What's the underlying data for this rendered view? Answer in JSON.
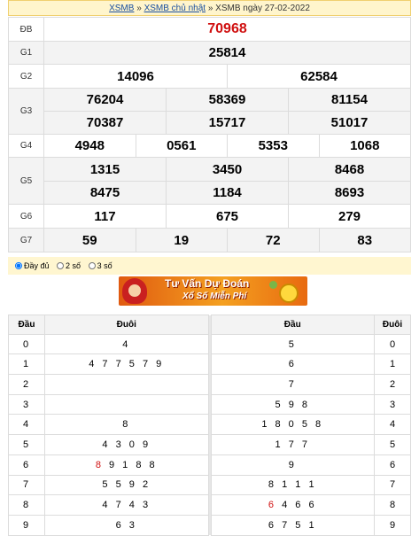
{
  "breadcrumb": {
    "link1": "XSMB",
    "sep1": "»",
    "link2": "XSMB chủ nhật",
    "sep2": "»",
    "current": "XSMB ngày 27-02-2022"
  },
  "results": [
    {
      "label": "ĐB",
      "numbers": [
        "70968"
      ]
    },
    {
      "label": "G1",
      "numbers": [
        "25814"
      ]
    },
    {
      "label": "G2",
      "numbers": [
        "14096",
        "62584"
      ]
    },
    {
      "label": "G3",
      "rows": [
        [
          "76204",
          "58369",
          "81154"
        ],
        [
          "70387",
          "15717",
          "51017"
        ]
      ]
    },
    {
      "label": "G4",
      "numbers": [
        "4948",
        "0561",
        "5353",
        "1068"
      ]
    },
    {
      "label": "G5",
      "rows": [
        [
          "1315",
          "3450",
          "8468"
        ],
        [
          "8475",
          "1184",
          "8693"
        ]
      ]
    },
    {
      "label": "G6",
      "numbers": [
        "117",
        "675",
        "279"
      ]
    },
    {
      "label": "G7",
      "numbers": [
        "59",
        "19",
        "72",
        "83"
      ]
    }
  ],
  "options": {
    "full": "Đầy đủ",
    "two": "2 số",
    "three": "3 số"
  },
  "banner": {
    "line1": "Tư Vấn Dự Đoán",
    "line2": "Xổ Số Miễn Phí"
  },
  "loto": {
    "headers": [
      "Đầu",
      "Đuôi",
      "Đầu",
      "Đuôi"
    ],
    "rows": [
      {
        "k": "0",
        "dau": "4",
        "duoi": "5",
        "k2": "0"
      },
      {
        "k": "1",
        "dau": "4 7 7 5 7 9",
        "duoi": "6",
        "k2": "1"
      },
      {
        "k": "2",
        "dau": "",
        "duoi": "7",
        "k2": "2"
      },
      {
        "k": "3",
        "dau": "",
        "duoi": "5 9 8",
        "k2": "3"
      },
      {
        "k": "4",
        "dau": "8",
        "duoi": "1 8 0 5 8",
        "k2": "4"
      },
      {
        "k": "5",
        "dau": "4 3 0 9",
        "duoi": "1 7 7",
        "k2": "5"
      },
      {
        "k": "6",
        "dau_red": "8",
        "dau": " 9 1 8 8",
        "duoi": "9",
        "k2": "6"
      },
      {
        "k": "7",
        "dau": "5 5 9 2",
        "duoi": "8 1 1 1",
        "k2": "7"
      },
      {
        "k": "8",
        "dau": "4 7 4 3",
        "duoi_red": "6",
        "duoi": " 4 6 6",
        "k2": "8"
      },
      {
        "k": "9",
        "dau": "6 3",
        "duoi": "6 7 5 1",
        "k2": "9"
      }
    ]
  }
}
